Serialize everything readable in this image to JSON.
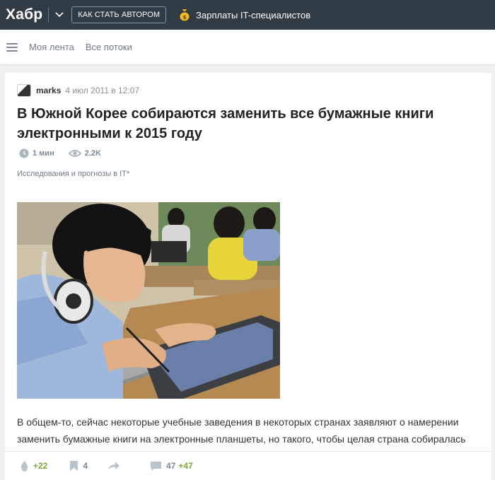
{
  "header": {
    "logo": "Хабр",
    "author_button": "КАК СТАТЬ АВТОРОМ",
    "salary_link": "Зарплаты IT-специалистов"
  },
  "nav": {
    "links": [
      "Моя лента",
      "Все потоки"
    ]
  },
  "article": {
    "author": "marks",
    "date": "4 июл 2011 в 12:07",
    "title": "В Южной Корее собираются заменить все бумажные книги электронными к 2015 году",
    "reading_time": "1 мин",
    "views": "2.2K",
    "hub": "Исследования и прогнозы в IT*",
    "text": "В общем-то, сейчас некоторые учебные заведения в некоторых странах заявляют о намерении заменить бумажные книги на электронные планшеты, но такого, чтобы целая страна собиралась"
  },
  "footer": {
    "rating": "+22",
    "bookmarks": "4",
    "comments": "47",
    "new_comments": "+47"
  },
  "colors": {
    "topbar": "#303b44",
    "accent_green": "#7ba83a",
    "icon_gray": "#9aa5b0"
  }
}
